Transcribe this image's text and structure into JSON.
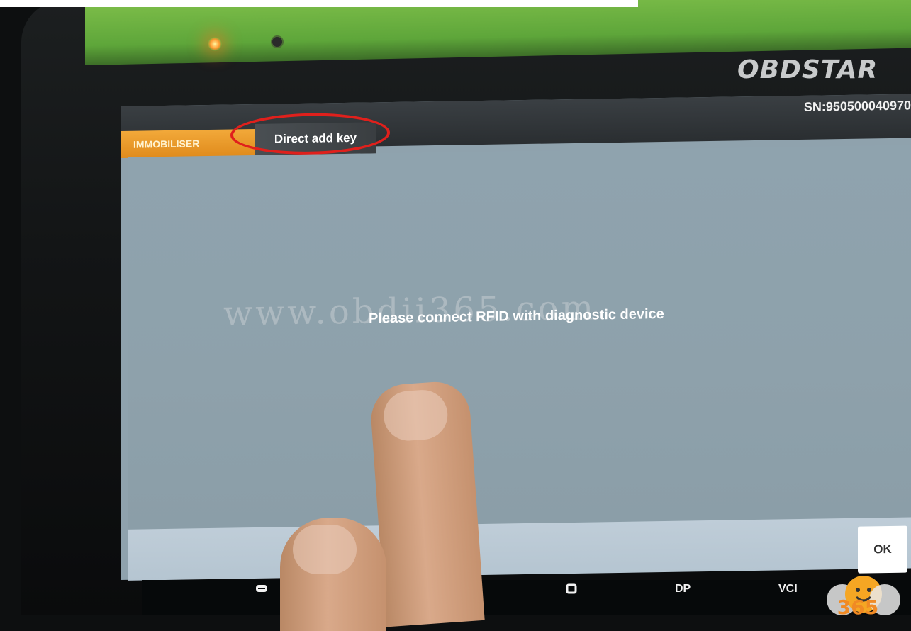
{
  "device": {
    "brand": "OBDSTAR",
    "serial": "SN:950500040970"
  },
  "tabs": {
    "immobiliser": "IMMOBILISER",
    "direct_add_key": "Direct add key"
  },
  "dialog": {
    "message": "Please connect RFID with diagnostic device",
    "ok_label": "OK"
  },
  "navbar": {
    "dp_label": "DP",
    "vci_label": "VCI"
  },
  "watermark": {
    "text": "www.obdii365.com"
  },
  "logo": {
    "text": "365"
  },
  "colors": {
    "accent_tab": "#e08b1c",
    "annotation": "#e0201c",
    "screen_bg": "#8fa2ad",
    "bottom_bar": "#bfcdd8"
  }
}
